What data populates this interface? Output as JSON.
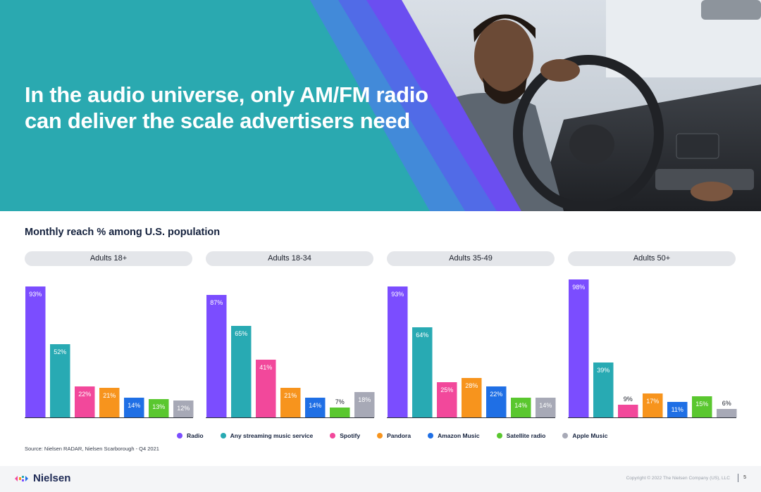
{
  "hero": {
    "title_line1": "In the audio universe, only AM/FM radio",
    "title_line2": "can deliver the scale advertisers need",
    "background_color": "#2aa9b0",
    "accent_color": "#6b4ef0"
  },
  "chart_data": {
    "type": "bar",
    "title": "Monthly reach % among U.S. population",
    "categories": [
      "Radio",
      "Any streaming music service",
      "Spotify",
      "Pandora",
      "Amazon Music",
      "Satellite radio",
      "Apple Music"
    ],
    "colors": [
      "#7b4dff",
      "#28aab3",
      "#f2489b",
      "#f7941d",
      "#1f6fe5",
      "#5ac72f",
      "#a7a9b6"
    ],
    "panels": [
      {
        "name": "Adults 18+",
        "values": [
          93,
          52,
          22,
          21,
          14,
          13,
          12
        ],
        "labels": [
          "93%",
          "52%",
          "22%",
          "21%",
          "14%",
          "13%",
          "12%"
        ]
      },
      {
        "name": "Adults 18-34",
        "values": [
          87,
          65,
          41,
          21,
          14,
          7,
          18
        ],
        "labels": [
          "87%",
          "65%",
          "41%",
          "21%",
          "14%",
          "7%",
          "18%"
        ]
      },
      {
        "name": "Adults 35-49",
        "values": [
          93,
          64,
          25,
          28,
          22,
          14,
          14
        ],
        "labels": [
          "93%",
          "64%",
          "25%",
          "28%",
          "22%",
          "14%",
          "14%"
        ]
      },
      {
        "name": "Adults 50+",
        "values": [
          98,
          39,
          9,
          17,
          11,
          15,
          6
        ],
        "labels": [
          "98%",
          "39%",
          "9%",
          "17%",
          "11%",
          "15%",
          "6%"
        ]
      }
    ],
    "ylim": [
      0,
      100
    ],
    "legend": [
      "Radio",
      "Any streaming music service",
      "Spotify",
      "Pandora",
      "Amazon Music",
      "Satellite radio",
      "Apple Music"
    ],
    "legend_position": "bottom",
    "grid": false
  },
  "source": "Source: Nielsen RADAR, Nielsen Scarborough - Q4 2021",
  "footer": {
    "logo_text": "Nielsen",
    "copyright": "Copyright © 2022 The Nielsen Company (US), LLC",
    "page_number": "5"
  }
}
